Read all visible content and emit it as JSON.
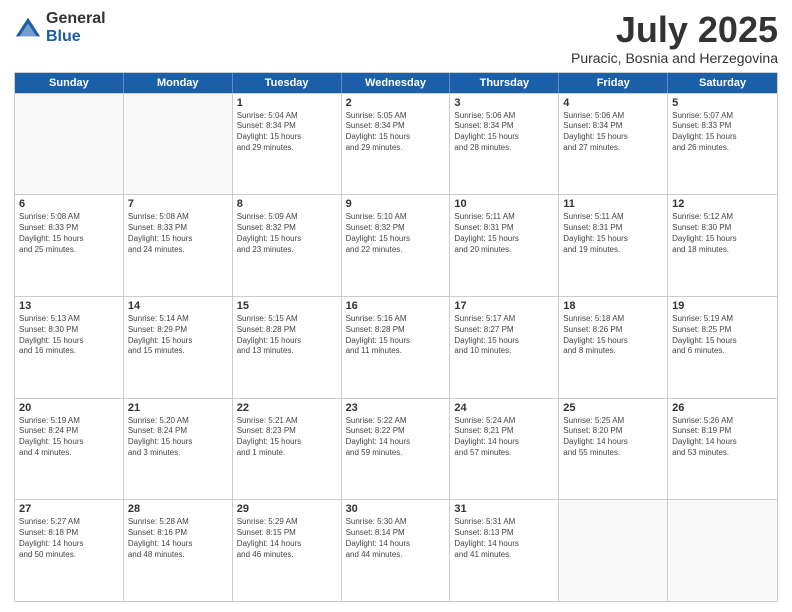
{
  "logo": {
    "general": "General",
    "blue": "Blue"
  },
  "header": {
    "month": "July 2025",
    "location": "Puracic, Bosnia and Herzegovina"
  },
  "days": [
    "Sunday",
    "Monday",
    "Tuesday",
    "Wednesday",
    "Thursday",
    "Friday",
    "Saturday"
  ],
  "rows": [
    [
      {
        "day": "",
        "lines": []
      },
      {
        "day": "",
        "lines": []
      },
      {
        "day": "1",
        "lines": [
          "Sunrise: 5:04 AM",
          "Sunset: 8:34 PM",
          "Daylight: 15 hours",
          "and 29 minutes."
        ]
      },
      {
        "day": "2",
        "lines": [
          "Sunrise: 5:05 AM",
          "Sunset: 8:34 PM",
          "Daylight: 15 hours",
          "and 29 minutes."
        ]
      },
      {
        "day": "3",
        "lines": [
          "Sunrise: 5:06 AM",
          "Sunset: 8:34 PM",
          "Daylight: 15 hours",
          "and 28 minutes."
        ]
      },
      {
        "day": "4",
        "lines": [
          "Sunrise: 5:06 AM",
          "Sunset: 8:34 PM",
          "Daylight: 15 hours",
          "and 27 minutes."
        ]
      },
      {
        "day": "5",
        "lines": [
          "Sunrise: 5:07 AM",
          "Sunset: 8:33 PM",
          "Daylight: 15 hours",
          "and 26 minutes."
        ]
      }
    ],
    [
      {
        "day": "6",
        "lines": [
          "Sunrise: 5:08 AM",
          "Sunset: 8:33 PM",
          "Daylight: 15 hours",
          "and 25 minutes."
        ]
      },
      {
        "day": "7",
        "lines": [
          "Sunrise: 5:08 AM",
          "Sunset: 8:33 PM",
          "Daylight: 15 hours",
          "and 24 minutes."
        ]
      },
      {
        "day": "8",
        "lines": [
          "Sunrise: 5:09 AM",
          "Sunset: 8:32 PM",
          "Daylight: 15 hours",
          "and 23 minutes."
        ]
      },
      {
        "day": "9",
        "lines": [
          "Sunrise: 5:10 AM",
          "Sunset: 8:32 PM",
          "Daylight: 15 hours",
          "and 22 minutes."
        ]
      },
      {
        "day": "10",
        "lines": [
          "Sunrise: 5:11 AM",
          "Sunset: 8:31 PM",
          "Daylight: 15 hours",
          "and 20 minutes."
        ]
      },
      {
        "day": "11",
        "lines": [
          "Sunrise: 5:11 AM",
          "Sunset: 8:31 PM",
          "Daylight: 15 hours",
          "and 19 minutes."
        ]
      },
      {
        "day": "12",
        "lines": [
          "Sunrise: 5:12 AM",
          "Sunset: 8:30 PM",
          "Daylight: 15 hours",
          "and 18 minutes."
        ]
      }
    ],
    [
      {
        "day": "13",
        "lines": [
          "Sunrise: 5:13 AM",
          "Sunset: 8:30 PM",
          "Daylight: 15 hours",
          "and 16 minutes."
        ]
      },
      {
        "day": "14",
        "lines": [
          "Sunrise: 5:14 AM",
          "Sunset: 8:29 PM",
          "Daylight: 15 hours",
          "and 15 minutes."
        ]
      },
      {
        "day": "15",
        "lines": [
          "Sunrise: 5:15 AM",
          "Sunset: 8:28 PM",
          "Daylight: 15 hours",
          "and 13 minutes."
        ]
      },
      {
        "day": "16",
        "lines": [
          "Sunrise: 5:16 AM",
          "Sunset: 8:28 PM",
          "Daylight: 15 hours",
          "and 11 minutes."
        ]
      },
      {
        "day": "17",
        "lines": [
          "Sunrise: 5:17 AM",
          "Sunset: 8:27 PM",
          "Daylight: 15 hours",
          "and 10 minutes."
        ]
      },
      {
        "day": "18",
        "lines": [
          "Sunrise: 5:18 AM",
          "Sunset: 8:26 PM",
          "Daylight: 15 hours",
          "and 8 minutes."
        ]
      },
      {
        "day": "19",
        "lines": [
          "Sunrise: 5:19 AM",
          "Sunset: 8:25 PM",
          "Daylight: 15 hours",
          "and 6 minutes."
        ]
      }
    ],
    [
      {
        "day": "20",
        "lines": [
          "Sunrise: 5:19 AM",
          "Sunset: 8:24 PM",
          "Daylight: 15 hours",
          "and 4 minutes."
        ]
      },
      {
        "day": "21",
        "lines": [
          "Sunrise: 5:20 AM",
          "Sunset: 8:24 PM",
          "Daylight: 15 hours",
          "and 3 minutes."
        ]
      },
      {
        "day": "22",
        "lines": [
          "Sunrise: 5:21 AM",
          "Sunset: 8:23 PM",
          "Daylight: 15 hours",
          "and 1 minute."
        ]
      },
      {
        "day": "23",
        "lines": [
          "Sunrise: 5:22 AM",
          "Sunset: 8:22 PM",
          "Daylight: 14 hours",
          "and 59 minutes."
        ]
      },
      {
        "day": "24",
        "lines": [
          "Sunrise: 5:24 AM",
          "Sunset: 8:21 PM",
          "Daylight: 14 hours",
          "and 57 minutes."
        ]
      },
      {
        "day": "25",
        "lines": [
          "Sunrise: 5:25 AM",
          "Sunset: 8:20 PM",
          "Daylight: 14 hours",
          "and 55 minutes."
        ]
      },
      {
        "day": "26",
        "lines": [
          "Sunrise: 5:26 AM",
          "Sunset: 8:19 PM",
          "Daylight: 14 hours",
          "and 53 minutes."
        ]
      }
    ],
    [
      {
        "day": "27",
        "lines": [
          "Sunrise: 5:27 AM",
          "Sunset: 8:18 PM",
          "Daylight: 14 hours",
          "and 50 minutes."
        ]
      },
      {
        "day": "28",
        "lines": [
          "Sunrise: 5:28 AM",
          "Sunset: 8:16 PM",
          "Daylight: 14 hours",
          "and 48 minutes."
        ]
      },
      {
        "day": "29",
        "lines": [
          "Sunrise: 5:29 AM",
          "Sunset: 8:15 PM",
          "Daylight: 14 hours",
          "and 46 minutes."
        ]
      },
      {
        "day": "30",
        "lines": [
          "Sunrise: 5:30 AM",
          "Sunset: 8:14 PM",
          "Daylight: 14 hours",
          "and 44 minutes."
        ]
      },
      {
        "day": "31",
        "lines": [
          "Sunrise: 5:31 AM",
          "Sunset: 8:13 PM",
          "Daylight: 14 hours",
          "and 41 minutes."
        ]
      },
      {
        "day": "",
        "lines": []
      },
      {
        "day": "",
        "lines": []
      }
    ]
  ]
}
